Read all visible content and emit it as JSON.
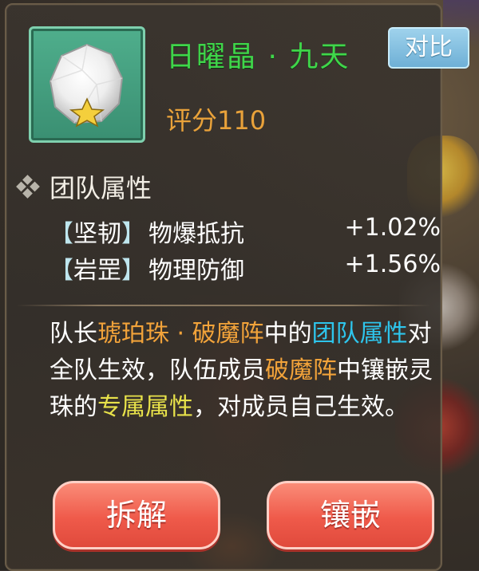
{
  "item": {
    "name": "日曜晶 · 九天",
    "score": "评分110",
    "compare_label": "对比",
    "icon": "gem-star-icon"
  },
  "team_attributes": {
    "title": "团队属性",
    "rows": [
      {
        "open": "【",
        "tag": "坚韧",
        "close": "】",
        "name": "物爆抵抗",
        "value": "+1.02%"
      },
      {
        "open": "【",
        "tag": "岩罡",
        "close": "】",
        "name": "物理防御",
        "value": "+1.56%"
      }
    ]
  },
  "description": {
    "segments": [
      {
        "text": "队长",
        "style": "white"
      },
      {
        "text": "琥珀珠 · 破魔阵",
        "style": "orange"
      },
      {
        "text": "中的",
        "style": "white"
      },
      {
        "text": "团队属性",
        "style": "blue"
      },
      {
        "text": "对全队生效，队伍成员",
        "style": "white"
      },
      {
        "text": "破魔阵",
        "style": "orange"
      },
      {
        "text": "中镶嵌灵珠的",
        "style": "white"
      },
      {
        "text": "专属属性",
        "style": "yellow"
      },
      {
        "text": "，对成员自己生效。",
        "style": "white"
      }
    ]
  },
  "actions": {
    "dismantle_label": "拆解",
    "inlay_label": "镶嵌"
  },
  "colors": {
    "title": "#3fd64a",
    "score": "#e9a23a",
    "highlight_orange": "#f2a33a",
    "highlight_blue": "#2ec5ec",
    "highlight_yellow": "#e8e24a",
    "button_red": "#ef5a4a",
    "compare_blue": "#6fb0d6"
  }
}
